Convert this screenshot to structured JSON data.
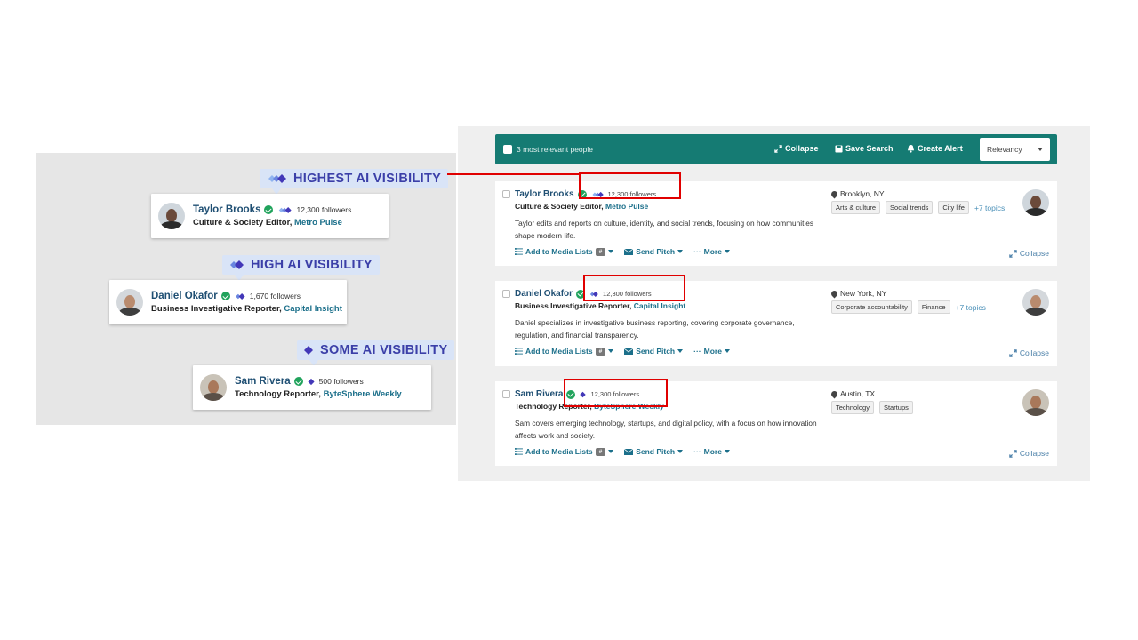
{
  "legend": {
    "items": [
      {
        "badge": "HIGHEST AI VISIBILITY",
        "name": "Taylor Brooks",
        "followers": "12,300 followers",
        "title": "Culture & Society Editor, ",
        "outlet": "Metro Pulse"
      },
      {
        "badge": "HIGH AI VISIBILITY",
        "name": "Daniel Okafor",
        "followers": "1,670 followers",
        "title": "Business Investigative Reporter, ",
        "outlet": "Capital Insight"
      },
      {
        "badge": "SOME AI VISIBILITY",
        "name": "Sam Rivera",
        "followers": "500 followers",
        "title": "Technology Reporter, ",
        "outlet": "ByteSphere Weekly"
      }
    ]
  },
  "toolbar": {
    "select_all_label": "3 most relevant people",
    "collapse_label": "Collapse",
    "save_search_label": "Save Search",
    "create_alert_label": "Create Alert",
    "sort_value": "Relevancy"
  },
  "results": [
    {
      "name": "Taylor Brooks",
      "followers": "12,300 followers",
      "title": "Culture & Society Editor, ",
      "outlet": "Metro Pulse",
      "bio": "Taylor edits and reports on culture, identity, and social trends, focusing on how communities shape modern life.",
      "location": "Brooklyn, NY",
      "tags": [
        "Arts & culture",
        "Social trends",
        "City life"
      ],
      "more_topics": "+7 topics"
    },
    {
      "name": "Daniel Okafor",
      "followers": "12,300 followers",
      "title": "Business Investigative Reporter, ",
      "outlet": "Capital Insight",
      "bio": "Daniel specializes in investigative business reporting, covering corporate governance, regulation, and financial transparency.",
      "location": "New York, NY",
      "tags": [
        "Corporate accountability",
        "Finance"
      ],
      "more_topics": "+7 topics"
    },
    {
      "name": "Sam Rivera",
      "followers": "12,300 followers",
      "title": "Technology Reporter, ",
      "outlet": "ByteSphere Weekly",
      "bio": "Sam covers emerging technology, startups, and digital policy, with a focus on how innovation affects work and society.",
      "location": "Austin, TX",
      "tags": [
        "Technology",
        "Startups"
      ],
      "more_topics": ""
    }
  ],
  "actions": {
    "add_to_lists": "Add to Media Lists",
    "hash": "#",
    "send_pitch": "Send Pitch",
    "more": "More",
    "collapse": "Collapse"
  },
  "icons": {
    "ai_visibility": "diamond-sparkle-icon",
    "verified": "check-circle-icon",
    "location": "map-pin-icon",
    "collapse": "collapse-arrows-icon",
    "save": "floppy-disk-icon",
    "alert": "bell-icon",
    "list": "list-icon",
    "mail": "envelope-icon"
  },
  "colors": {
    "toolbar": "#157b73",
    "name": "#1f4f73",
    "link": "#1b6f8a",
    "verified": "#21a35c",
    "ai_badge_bg": "#d9e4f7",
    "ai_badge_text": "#3b3fa8",
    "highlight": "#e00000"
  }
}
